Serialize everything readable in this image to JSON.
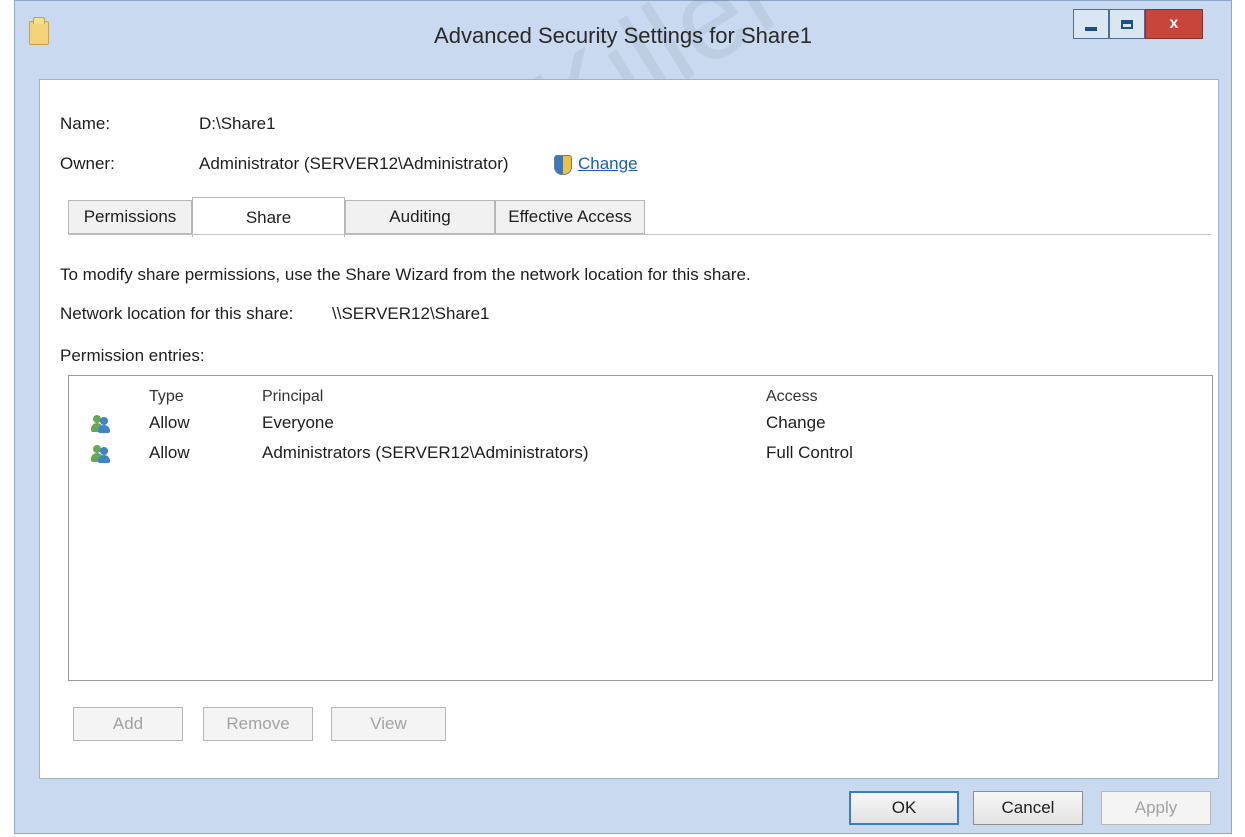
{
  "window": {
    "title": "Advanced Security Settings for Share1",
    "buttons": {
      "minimize_label": "",
      "maximize_label": "",
      "close_label": "x"
    }
  },
  "fields": {
    "name_label": "Name:",
    "name_value": "D:\\Share1",
    "owner_label": "Owner:",
    "owner_value": "Administrator (SERVER12\\Administrator)",
    "change_link": "Change"
  },
  "tabs": [
    {
      "label": "Permissions",
      "active": false
    },
    {
      "label": "Share",
      "active": true
    },
    {
      "label": "Auditing",
      "active": false
    },
    {
      "label": "Effective Access",
      "active": false
    }
  ],
  "share": {
    "info_text": "To modify share permissions, use the Share Wizard from the network location for this share.",
    "network_location_label": "Network location for this share:",
    "network_location_value": "\\\\SERVER12\\Share1",
    "entries_label": "Permission entries:"
  },
  "permission_table": {
    "columns": [
      "Type",
      "Principal",
      "Access"
    ],
    "rows": [
      {
        "icon": "users-icon",
        "type": "Allow",
        "principal": "Everyone",
        "access": "Change"
      },
      {
        "icon": "users-icon",
        "type": "Allow",
        "principal": "Administrators (SERVER12\\Administrators)",
        "access": "Full Control"
      }
    ]
  },
  "entry_buttons": {
    "add_label": "Add",
    "remove_label": "Remove",
    "view_label": "View"
  },
  "dialog_buttons": {
    "ok_label": "OK",
    "cancel_label": "Cancel",
    "apply_label": "Apply"
  },
  "watermark": "CertKiller"
}
